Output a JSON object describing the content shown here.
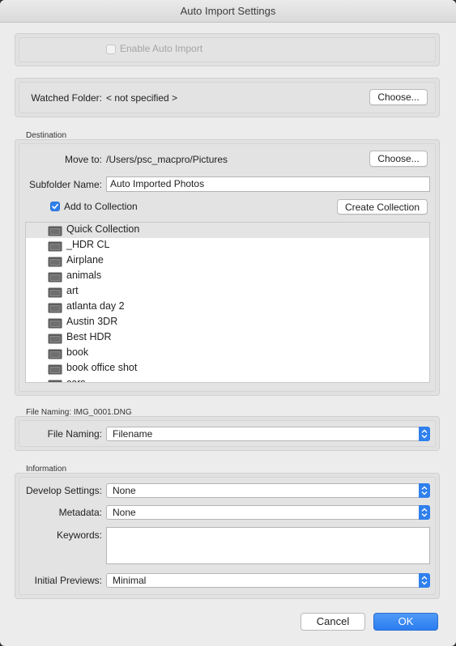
{
  "window": {
    "title": "Auto Import Settings"
  },
  "auto_import": {
    "label": "Enable Auto Import",
    "checked": false
  },
  "watched": {
    "label": "Watched Folder:",
    "value": "< not specified >",
    "choose": "Choose..."
  },
  "destination": {
    "heading": "Destination",
    "move_to_label": "Move to:",
    "move_to_value": "/Users/psc_macpro/Pictures",
    "choose": "Choose...",
    "subfolder_label": "Subfolder Name:",
    "subfolder_value": "Auto Imported Photos",
    "add_to_collection_label": "Add to Collection",
    "add_to_collection_checked": true,
    "create_collection": "Create Collection",
    "collections": [
      "Quick Collection",
      "_HDR CL",
      "Airplane",
      "animals",
      "art",
      "atlanta day 2",
      "Austin 3DR",
      "Best HDR",
      "book",
      "book office shot",
      "cars"
    ],
    "selected_collection": "Quick Collection"
  },
  "file_naming": {
    "heading": "File Naming:  IMG_0001.DNG",
    "label": "File Naming:",
    "value": "Filename"
  },
  "information": {
    "heading": "Information",
    "develop_label": "Develop Settings:",
    "develop_value": "None",
    "metadata_label": "Metadata:",
    "metadata_value": "None",
    "keywords_label": "Keywords:",
    "keywords_value": "",
    "previews_label": "Initial Previews:",
    "previews_value": "Minimal"
  },
  "buttons": {
    "cancel": "Cancel",
    "ok": "OK"
  },
  "colors": {
    "accent": "#2f80ed"
  }
}
